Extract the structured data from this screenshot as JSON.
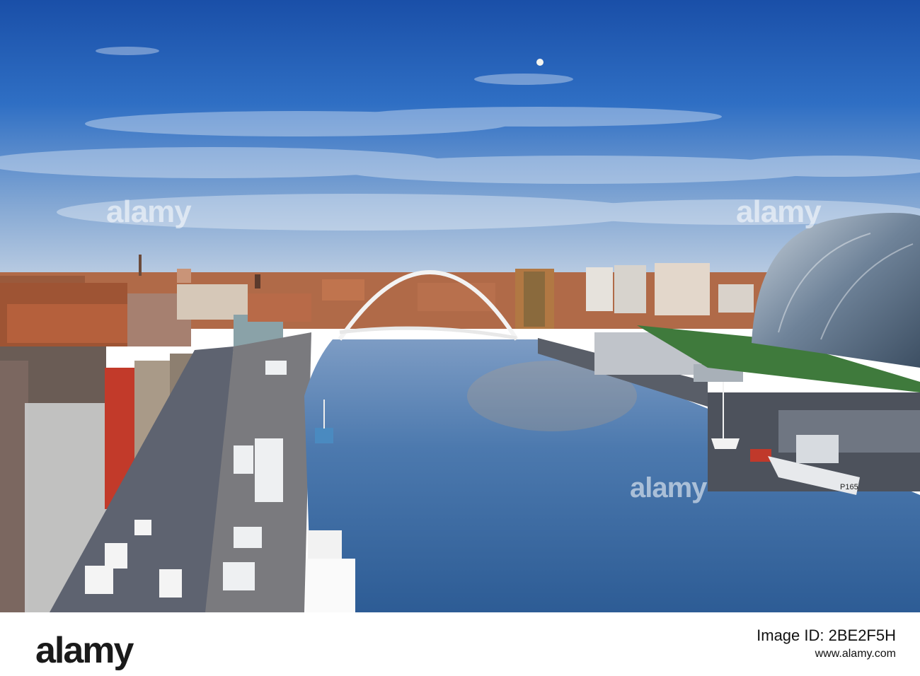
{
  "watermark": {
    "text": "alamy"
  },
  "hull_marking": "P165",
  "footer": {
    "logo_text": "alamy",
    "image_id": "Image ID: 2BE2F5H",
    "site": "www.alamy.com"
  },
  "colors": {
    "sky_top": "#1f5fb8",
    "sky_horizon": "#b9cde6",
    "river": "#3f6fa6",
    "brick": "#a0563a",
    "glass": "#7f93a8"
  }
}
